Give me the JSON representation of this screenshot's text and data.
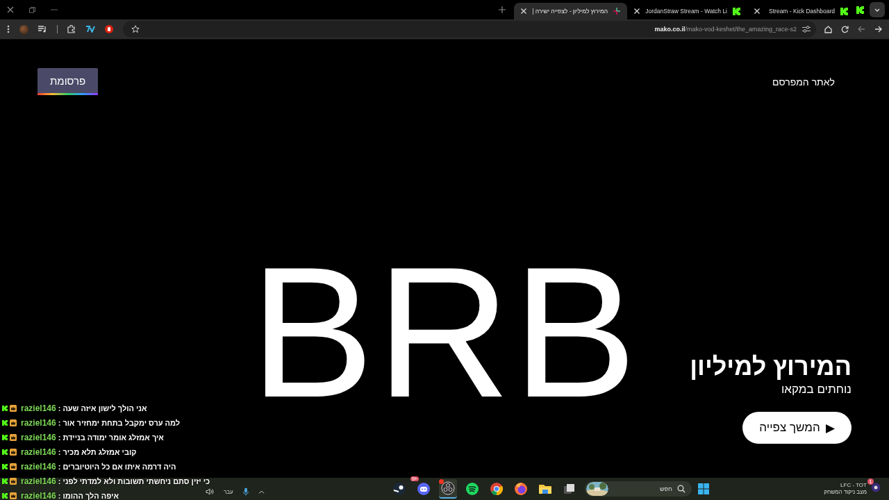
{
  "tabs": [
    {
      "label": "Stream - Kick Dashboard",
      "selected": false,
      "kind": "kick"
    },
    {
      "label": "JordanStraw Stream - Watch Li",
      "selected": false,
      "kind": "kick"
    },
    {
      "label": "המירוץ למיליון - לצפייה ישירה |",
      "selected": true,
      "kind": "mako"
    }
  ],
  "address": {
    "host": "mako.co.il",
    "path": "/mako-vod-keshet/the_amazing_race-s2"
  },
  "page": {
    "ad_label": "פרסומת",
    "advertiser_link": "לאתר המפרסם",
    "overlay_text": "BRB",
    "show_title": "המירוץ למיליון",
    "show_subtitle": "נוחתים במקאו",
    "continue_button": "המשך צפייה",
    "play_glyph": "▶"
  },
  "chat": {
    "separator": ":",
    "messages": [
      {
        "user": "raziel146",
        "text": "אני הולך לישון איזה שעה"
      },
      {
        "user": "raziel146",
        "text": "למה ערס ימקבל בתחת ימחזיר אור"
      },
      {
        "user": "raziel146",
        "text": "איך אמזלג אומר ימודה בניידת"
      },
      {
        "user": "raziel146",
        "text": "קובי אמזלג תלא מכיר"
      },
      {
        "user": "raziel146",
        "text": "היה דרמה איתו אם כל היוטיוברים"
      },
      {
        "user": "raziel146",
        "text": "כי יזין סתם ניחשתי תשובות ולא למדתי לפני"
      },
      {
        "user": "raziel146",
        "text": "איפה הלך ההומו"
      }
    ]
  },
  "taskbar": {
    "apps": [
      {
        "kind": "steam",
        "active": false
      },
      {
        "kind": "discord",
        "badge": "9+",
        "active": false
      },
      {
        "kind": "obs",
        "active": true
      },
      {
        "kind": "spotify",
        "active": false
      },
      {
        "kind": "chrome",
        "active": false
      },
      {
        "kind": "firefox",
        "active": false
      },
      {
        "kind": "folder",
        "active": false
      },
      {
        "kind": "taskview",
        "active": false
      }
    ],
    "search_placeholder": "חפש",
    "language": "עבר",
    "widget_title": "LFC - TOT",
    "widget_subtitle": "מצב ניקוד המשחק",
    "widget_badge": "1"
  }
}
